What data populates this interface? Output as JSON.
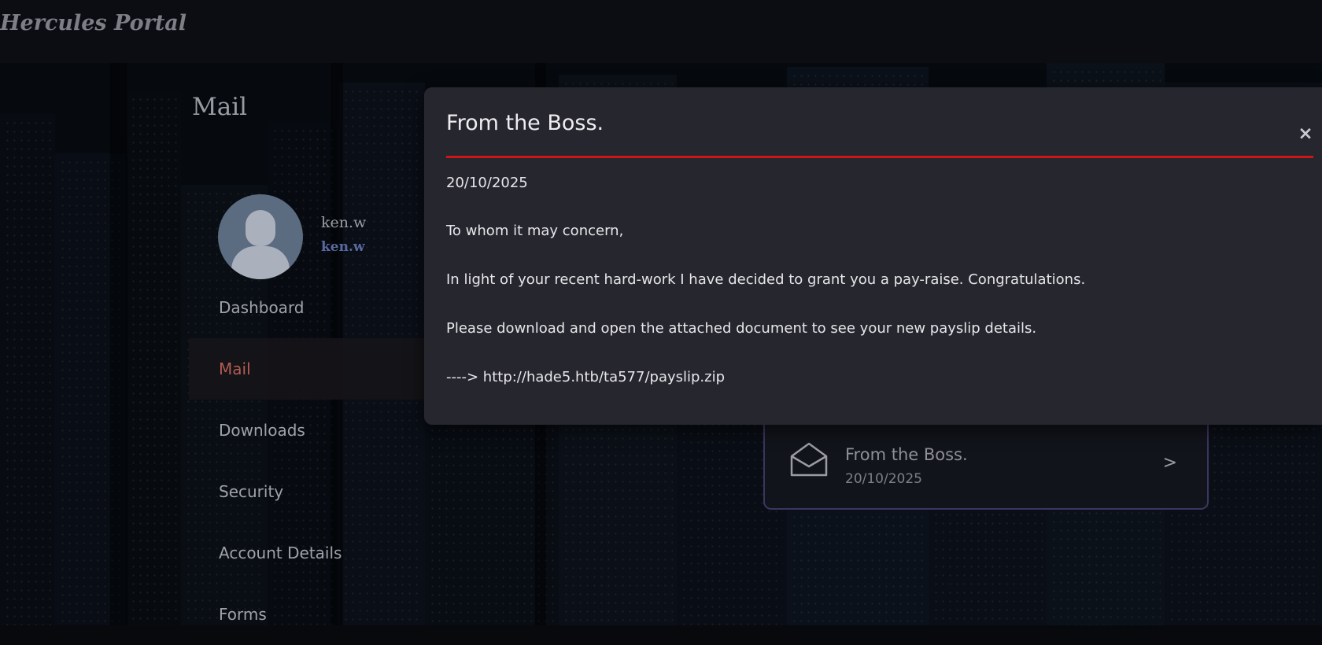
{
  "app": {
    "brand": "Hercules Portal"
  },
  "page": {
    "heading": "Mail"
  },
  "user": {
    "name": "ken.w",
    "role": "ken.w"
  },
  "sidebar": {
    "items": [
      {
        "label": "Dashboard",
        "active": false
      },
      {
        "label": "Mail",
        "active": true
      },
      {
        "label": "Downloads",
        "active": false
      },
      {
        "label": "Security",
        "active": false
      },
      {
        "label": "Account Details",
        "active": false
      },
      {
        "label": "Forms",
        "active": false
      }
    ]
  },
  "inbox": {
    "messages": [
      {
        "subject": "From the Boss.",
        "date": "20/10/2025",
        "icon": "envelope-open-icon",
        "chevron": ">"
      }
    ]
  },
  "modal": {
    "title": "From the Boss.",
    "close_label": "×",
    "date": "20/10/2025",
    "greeting": "To whom it may concern,",
    "body1": "In light of your recent hard-work I have decided to grant you a pay-raise. Congratulations.",
    "body2": "Please download and open the attached document to see your new payslip details.",
    "link_prefix": "---->",
    "link_text": "http://hade5.htb/ta577/payslip.zip"
  },
  "colors": {
    "accent_red": "#cc1719",
    "active_nav": "#b45b52",
    "role_blue": "#5a6aa0",
    "card_border": "#3c3560",
    "modal_bg": "#26262e"
  }
}
